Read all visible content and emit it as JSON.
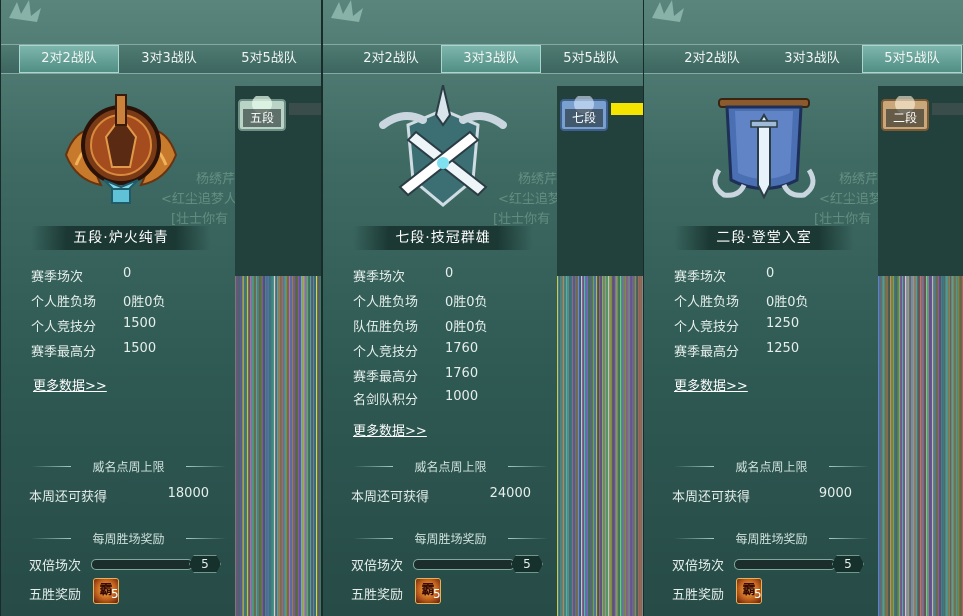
{
  "panels": [
    {
      "tabs": [
        {
          "label": "2对2战队",
          "active": true
        },
        {
          "label": "3对3战队",
          "active": false
        },
        {
          "label": "5对5战队",
          "active": false
        }
      ],
      "rank_title": "五段·炉火纯青",
      "stats": [
        {
          "label": "赛季场次",
          "value": "0"
        },
        {
          "label": "个人胜负场",
          "value": "0胜0负"
        },
        {
          "label": "个人竞技分",
          "value": "1500"
        },
        {
          "label": "赛季最高分",
          "value": "1500"
        }
      ],
      "more_link": "更多数据>>",
      "weekly_cap_title": "威名点周上限",
      "weekly_label": "本周还可获得",
      "weekly_value": "18000",
      "weekly_reward_title": "每周胜场奖励",
      "double_label": "双倍场次",
      "double_count": "5",
      "double_progress": 0,
      "five_win_label": "五胜奖励",
      "five_win_count": "5",
      "reward_glyph": "霸",
      "side_rank_label": "五段",
      "faint_texts": [
        "杨绣芹",
        "<红尘追梦人>",
        "[壮士你有"
      ]
    },
    {
      "tabs": [
        {
          "label": "2对2战队",
          "active": false
        },
        {
          "label": "3对3战队",
          "active": true
        },
        {
          "label": "5对5战队",
          "active": false
        }
      ],
      "rank_title": "七段·技冠群雄",
      "stats": [
        {
          "label": "赛季场次",
          "value": "0"
        },
        {
          "label": "个人胜负场",
          "value": "0胜0负"
        },
        {
          "label": "队伍胜负场",
          "value": "0胜0负"
        },
        {
          "label": "个人竞技分",
          "value": "1760"
        },
        {
          "label": "赛季最高分",
          "value": "1760"
        },
        {
          "label": "名剑队积分",
          "value": "1000"
        }
      ],
      "more_link": "更多数据>>",
      "weekly_cap_title": "威名点周上限",
      "weekly_label": "本周还可获得",
      "weekly_value": "24000",
      "weekly_reward_title": "每周胜场奖励",
      "double_label": "双倍场次",
      "double_count": "5",
      "double_progress": 0,
      "five_win_label": "五胜奖励",
      "five_win_count": "5",
      "reward_glyph": "霸",
      "side_rank_label": "七段",
      "faint_texts": [
        "杨绣芹",
        "<红尘追梦人>",
        "[壮士你有"
      ]
    },
    {
      "tabs": [
        {
          "label": "2对2战队",
          "active": false
        },
        {
          "label": "3对3战队",
          "active": false
        },
        {
          "label": "5对5战队",
          "active": true
        }
      ],
      "rank_title": "二段·登堂入室",
      "stats": [
        {
          "label": "赛季场次",
          "value": "0"
        },
        {
          "label": "个人胜负场",
          "value": "0胜0负"
        },
        {
          "label": "个人竞技分",
          "value": "1250"
        },
        {
          "label": "赛季最高分",
          "value": "1250"
        }
      ],
      "more_link": "更多数据>>",
      "weekly_cap_title": "威名点周上限",
      "weekly_label": "本周还可获得",
      "weekly_value": "9000",
      "weekly_reward_title": "每周胜场奖励",
      "double_label": "双倍场次",
      "double_count": "5",
      "double_progress": 0,
      "five_win_label": "五胜奖励",
      "five_win_count": "5",
      "reward_glyph": "霸",
      "side_rank_label": "二段",
      "faint_texts": [
        "杨绣芹",
        "<红尘追梦人>",
        "[壮士你有"
      ]
    }
  ],
  "colors": {
    "panel_bg": "#3f6b64",
    "tab_active": "#4f8d83",
    "accent_yellow": "#f5e400",
    "emblem_bronze": "#b8652a",
    "emblem_silver": "#c9d6df",
    "emblem_blue": "#4a6fb3"
  },
  "icons": [
    "top-ornament-icon",
    "rank-emblem-icon",
    "chest-icon",
    "reward-icon"
  ]
}
